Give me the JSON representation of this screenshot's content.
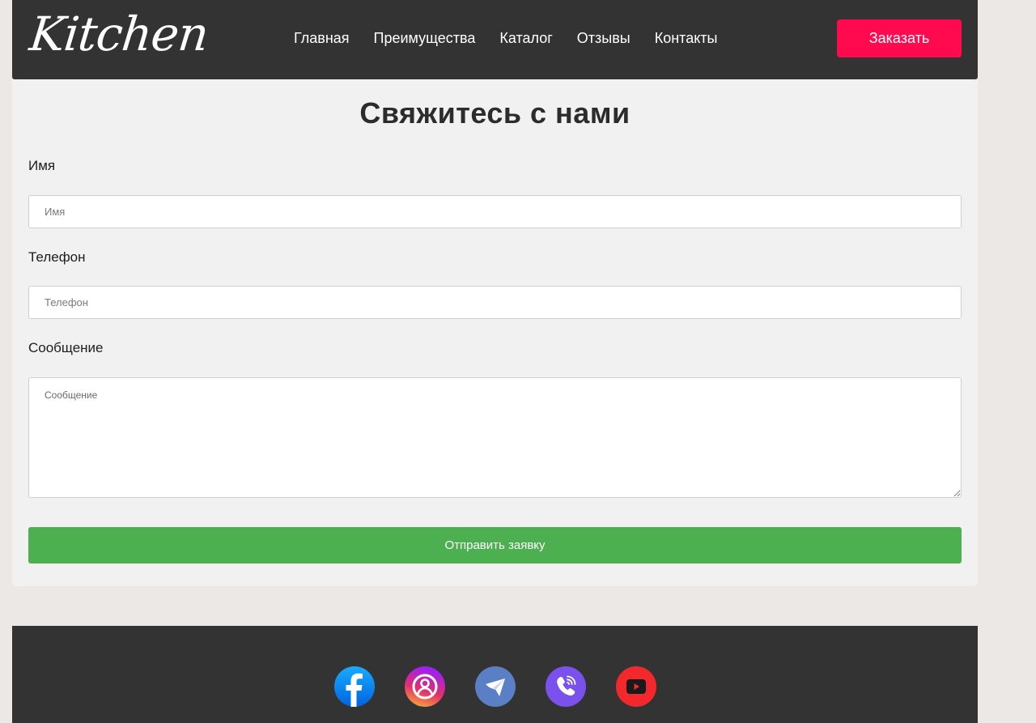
{
  "header": {
    "logo_text": "Kitchen",
    "nav": [
      {
        "label": "Главная"
      },
      {
        "label": "Преимущества"
      },
      {
        "label": "Каталог"
      },
      {
        "label": "Отзывы"
      },
      {
        "label": "Контакты"
      }
    ],
    "order_button": "Заказать"
  },
  "contact_form": {
    "title": "Свяжитесь с нами",
    "name_label": "Имя",
    "name_placeholder": "Имя",
    "phone_label": "Телефон",
    "phone_placeholder": "Телефон",
    "message_label": "Сообщение",
    "message_placeholder": "Сообщение",
    "submit_button": "Отправить заявку"
  },
  "footer": {
    "socials": [
      {
        "icon": "facebook-icon",
        "color": "#1877f2"
      },
      {
        "icon": "instagram-icon",
        "color": "#c13584"
      },
      {
        "icon": "telegram-icon",
        "color": "#5b7fc4"
      },
      {
        "icon": "viber-icon",
        "color": "#7b51ed"
      },
      {
        "icon": "youtube-icon",
        "color": "#f3282c"
      }
    ]
  },
  "colors": {
    "header_bg": "#333333",
    "order_button": "#ff0a4f",
    "submit_button": "#4caf50",
    "page_bg": "#ece8e6",
    "form_bg": "#f1f1f1"
  }
}
